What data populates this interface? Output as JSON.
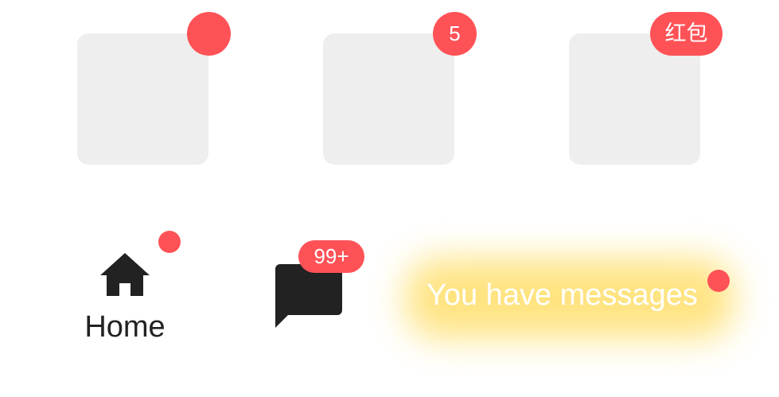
{
  "colors": {
    "badge": "#ff5257",
    "placeholder": "#eeeeee",
    "icon": "#222222",
    "glow": "#ffe27a"
  },
  "avatars": {
    "items": [
      {
        "badge_type": "dot"
      },
      {
        "badge_type": "count",
        "badge_text": "5"
      },
      {
        "badge_type": "text",
        "badge_text": "红包"
      }
    ]
  },
  "tabs": {
    "home": {
      "label": "Home",
      "icon": "home-icon",
      "badge_type": "dot"
    },
    "messages": {
      "icon": "chat-icon",
      "badge_text": "99+"
    },
    "notice": {
      "text": "You have messages",
      "badge_type": "dot"
    }
  }
}
